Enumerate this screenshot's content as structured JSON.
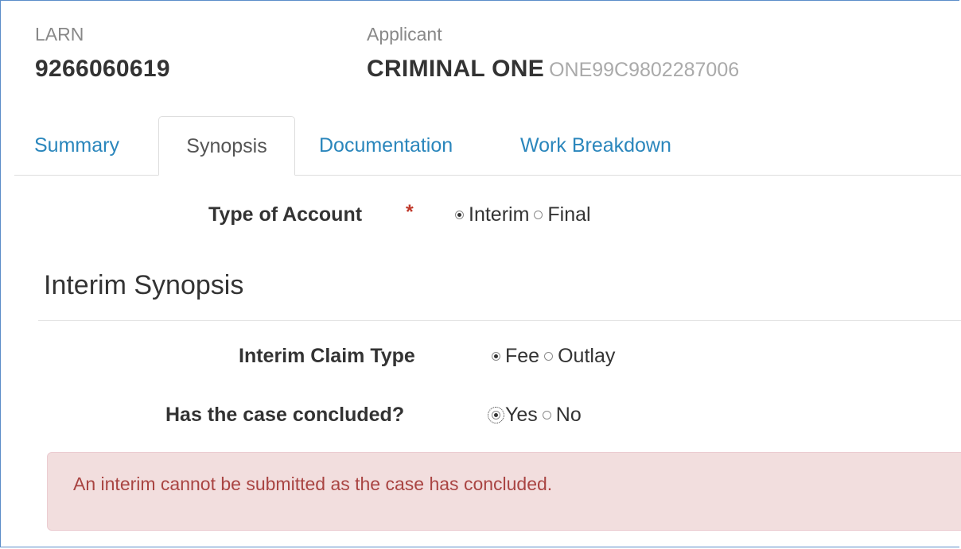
{
  "header": {
    "larn_label": "LARN",
    "larn_value": "9266060619",
    "applicant_label": "Applicant",
    "applicant_name": "CRIMINAL ONE",
    "applicant_ref": "ONE99C9802287006"
  },
  "tabs": [
    {
      "label": "Summary",
      "active": false
    },
    {
      "label": "Synopsis",
      "active": true
    },
    {
      "label": "Documentation",
      "active": false
    },
    {
      "label": "Work Breakdown",
      "active": false
    }
  ],
  "type_of_account": {
    "label": "Type of Account",
    "required_mark": "*",
    "options": [
      {
        "label": "Interim",
        "checked": true
      },
      {
        "label": "Final",
        "checked": false
      }
    ]
  },
  "section": {
    "title": "Interim Synopsis"
  },
  "interim_claim_type": {
    "label": "Interim Claim Type",
    "options": [
      {
        "label": "Fee",
        "checked": true
      },
      {
        "label": "Outlay",
        "checked": false
      }
    ]
  },
  "case_concluded": {
    "label": "Has the case concluded?",
    "options": [
      {
        "label": "Yes",
        "checked": true
      },
      {
        "label": "No",
        "checked": false
      }
    ]
  },
  "alert": {
    "message": "An interim cannot be submitted as the case has concluded."
  },
  "colors": {
    "link": "#2a86bc",
    "required": "#c0392b",
    "alert_bg": "#f2dede",
    "alert_text": "#a94442",
    "frame_border": "#5b8dc9"
  }
}
